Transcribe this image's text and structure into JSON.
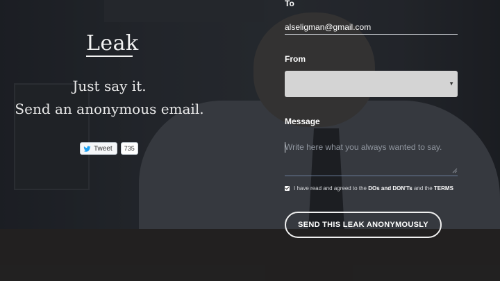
{
  "brand": {
    "logo": "Leak"
  },
  "hero": {
    "line1": "Just say it.",
    "line2": "Send an anonymous email."
  },
  "tweet": {
    "label": "Tweet",
    "count": "735"
  },
  "form": {
    "to_label": "To",
    "to_value": "alseligman@gmail.com",
    "from_label": "From",
    "from_value": "",
    "message_label": "Message",
    "message_placeholder": "Write here what you always wanted to say.",
    "agree_prefix": "I have read and agreed to the",
    "agree_link1": "DOs and DON'Ts",
    "agree_middle": "and the",
    "agree_link2": "TERMS",
    "agree_checked": true,
    "send_label": "SEND THIS LEAK ANONYMOUSLY"
  },
  "colors": {
    "background": "#24272c",
    "select_bg": "#d4d4d4",
    "text": "#ffffff",
    "twitter_blue": "#1da1f2"
  },
  "icons": {
    "tweet": "twitter-bird-icon",
    "select_arrow": "caret-down-icon",
    "checkbox": "check-icon"
  }
}
